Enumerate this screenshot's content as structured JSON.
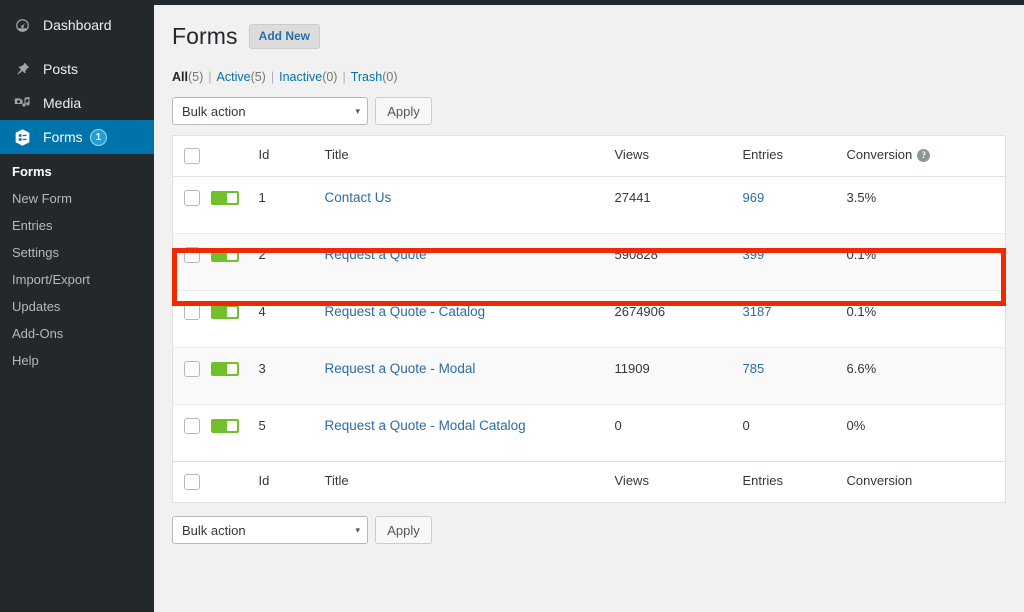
{
  "sidebar": {
    "items": [
      {
        "label": "Dashboard",
        "icon": "dashboard-gauge-icon",
        "name": "dashboard",
        "current": false,
        "badge": null
      },
      {
        "label": "Posts",
        "icon": "pin-icon",
        "name": "posts",
        "current": false,
        "badge": null
      },
      {
        "label": "Media",
        "icon": "media-icon",
        "name": "media",
        "current": false,
        "badge": null
      },
      {
        "label": "Forms",
        "icon": "forms-icon",
        "name": "forms",
        "current": true,
        "badge": "1"
      }
    ],
    "submenu": [
      {
        "label": "Forms",
        "current": true
      },
      {
        "label": "New Form",
        "current": false
      },
      {
        "label": "Entries",
        "current": false
      },
      {
        "label": "Settings",
        "current": false
      },
      {
        "label": "Import/Export",
        "current": false
      },
      {
        "label": "Updates",
        "current": false
      },
      {
        "label": "Add-Ons",
        "current": false
      },
      {
        "label": "Help",
        "current": false
      }
    ]
  },
  "header": {
    "title": "Forms",
    "add_new_label": "Add New"
  },
  "filters": [
    {
      "label": "All",
      "count": "(5)",
      "current": true
    },
    {
      "label": "Active",
      "count": "(5)",
      "current": false
    },
    {
      "label": "Inactive",
      "count": "(0)",
      "current": false
    },
    {
      "label": "Trash",
      "count": "(0)",
      "current": false
    }
  ],
  "bulk": {
    "selected": "Bulk action",
    "apply_label": "Apply",
    "caret": "▾"
  },
  "table": {
    "columns": {
      "id": "Id",
      "title": "Title",
      "views": "Views",
      "entries": "Entries",
      "conversion": "Conversion"
    },
    "conversion_help": "?",
    "rows": [
      {
        "id": "1",
        "title": "Contact Us",
        "views": "27441",
        "entries": "969",
        "conversion": "3.5%",
        "active": true,
        "highlighted": false
      },
      {
        "id": "2",
        "title": "Request a Quote",
        "views": "590828",
        "entries": "399",
        "conversion": "0.1%",
        "active": true,
        "highlighted": true
      },
      {
        "id": "4",
        "title": "Request a Quote - Catalog",
        "views": "2674906",
        "entries": "3187",
        "conversion": "0.1%",
        "active": true,
        "highlighted": false
      },
      {
        "id": "3",
        "title": "Request a Quote - Modal",
        "views": "11909",
        "entries": "785",
        "conversion": "6.6%",
        "active": true,
        "highlighted": false
      },
      {
        "id": "5",
        "title": "Request a Quote - Modal Catalog",
        "views": "0",
        "entries": "0",
        "conversion": "0%",
        "active": true,
        "highlighted": false
      }
    ]
  },
  "colors": {
    "sidebar_bg": "#23282d",
    "current_menu": "#0073aa",
    "link_blue": "#2d6ca2",
    "toggle_green": "#71c02b",
    "highlight_red": "#ef2a00"
  }
}
